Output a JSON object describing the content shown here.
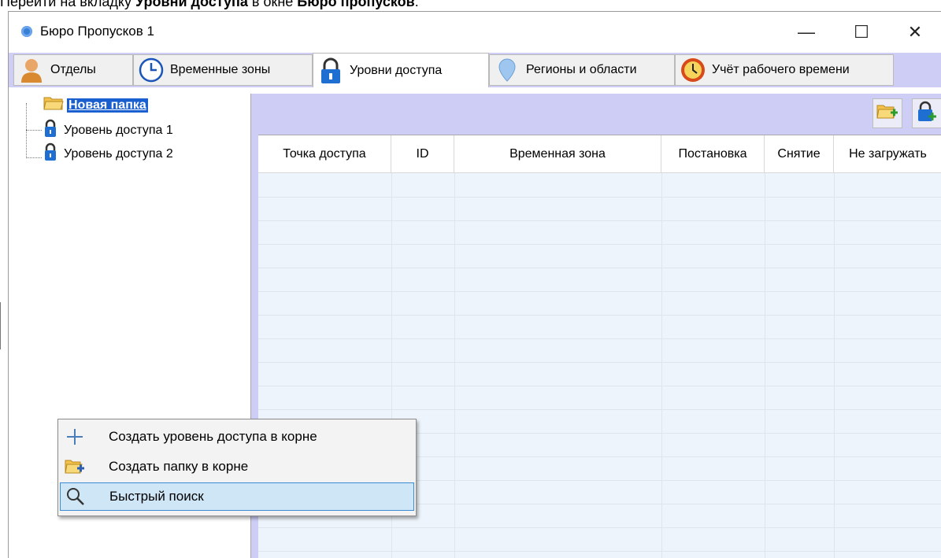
{
  "caption": {
    "prefix": "Перейти на вкладку ",
    "bold1": "Уровни доступа",
    "middle": " в окне ",
    "bold2": "Бюро пропусков",
    "suffix": "."
  },
  "window": {
    "title": "Бюро Пропусков 1",
    "minimize": "—",
    "maximize": "☐",
    "close": "✕"
  },
  "tabs": [
    {
      "label": "Отделы",
      "icon": "person-icon"
    },
    {
      "label": "Временные зоны",
      "icon": "clock-icon"
    },
    {
      "label": "Уровни доступа",
      "icon": "lock-icon",
      "active": true
    },
    {
      "label": "Регионы и области",
      "icon": "map-pin-icon"
    },
    {
      "label": "Учёт рабочего времени",
      "icon": "alarm-clock-icon"
    }
  ],
  "tree": {
    "folder": "Новая папка",
    "items": [
      "Уровень доступа 1",
      "Уровень доступа 2"
    ]
  },
  "grid": {
    "columns": [
      "Точка доступа",
      "ID",
      "Временная зона",
      "Постановка",
      "Снятие",
      "Не загружать"
    ]
  },
  "context_menu": {
    "items": [
      {
        "label": "Создать уровень доступа в корне",
        "icon": "plus-icon"
      },
      {
        "label": "Создать папку в корне",
        "icon": "add-folder-icon"
      },
      {
        "label": "Быстрый поиск",
        "icon": "search-icon",
        "highlighted": true
      }
    ]
  },
  "colors": {
    "accent": "#cdcdf6",
    "selection": "#1a5fd0",
    "grid": "#eef4fb"
  }
}
